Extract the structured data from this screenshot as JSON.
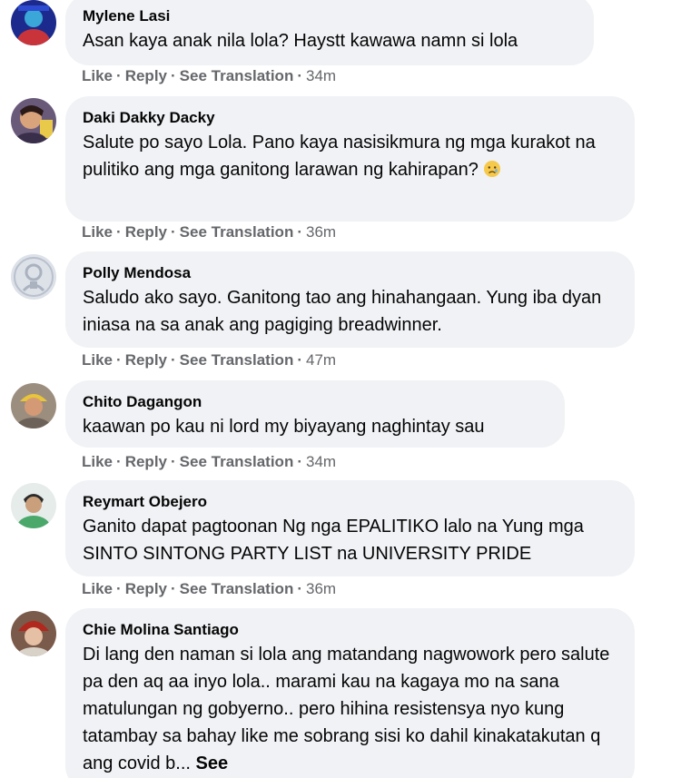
{
  "actions": {
    "like": "Like",
    "reply": "Reply",
    "translate": "See Translation",
    "separator": "·"
  },
  "comments": [
    {
      "author": "Mylene Lasi",
      "text": "Asan kaya anak nila lola? Haystt kawawa namn si lola",
      "time": "34m",
      "avatar_icon": "profile-photo"
    },
    {
      "author": "Daki Dakky Dacky",
      "text": "Salute po sayo Lola. Pano kaya nasisikmura ng mga kurakot na pulitiko ang mga ganitong larawan ng kahirapan?",
      "emoji": "sad-face-emoji",
      "time": "36m",
      "avatar_icon": "profile-photo"
    },
    {
      "author": "Polly Mendosa",
      "text": "Saludo ako sayo. Ganitong tao ang hinahangaan. Yung iba dyan iniasa na sa anak ang pagiging breadwinner.",
      "time": "47m",
      "avatar_icon": "default-profile-icon"
    },
    {
      "author": "Chito Dagangon",
      "text": "kaawan po kau ni lord my biyayang naghintay sau",
      "time": "34m",
      "avatar_icon": "profile-photo"
    },
    {
      "author": "Reymart Obejero",
      "text": "Ganito dapat pagtoonan Ng nga EPALITIKO lalo na Yung mga SINTO SINTONG PARTY LIST na UNIVERSITY PRIDE",
      "time": "36m",
      "avatar_icon": "profile-photo"
    },
    {
      "author": "Chie Molina Santiago",
      "text": "Di lang den naman si lola ang matandang nagwowork pero salute pa den aq aa inyo lola.. marami kau na kagaya mo na sana matulungan ng gobyerno.. pero hihina resistensya nyo kung tatambay sa bahay like me sobrang sisi ko dahil kinakatakutan q ang covid b...",
      "see_more": "See",
      "avatar_icon": "profile-photo"
    }
  ]
}
